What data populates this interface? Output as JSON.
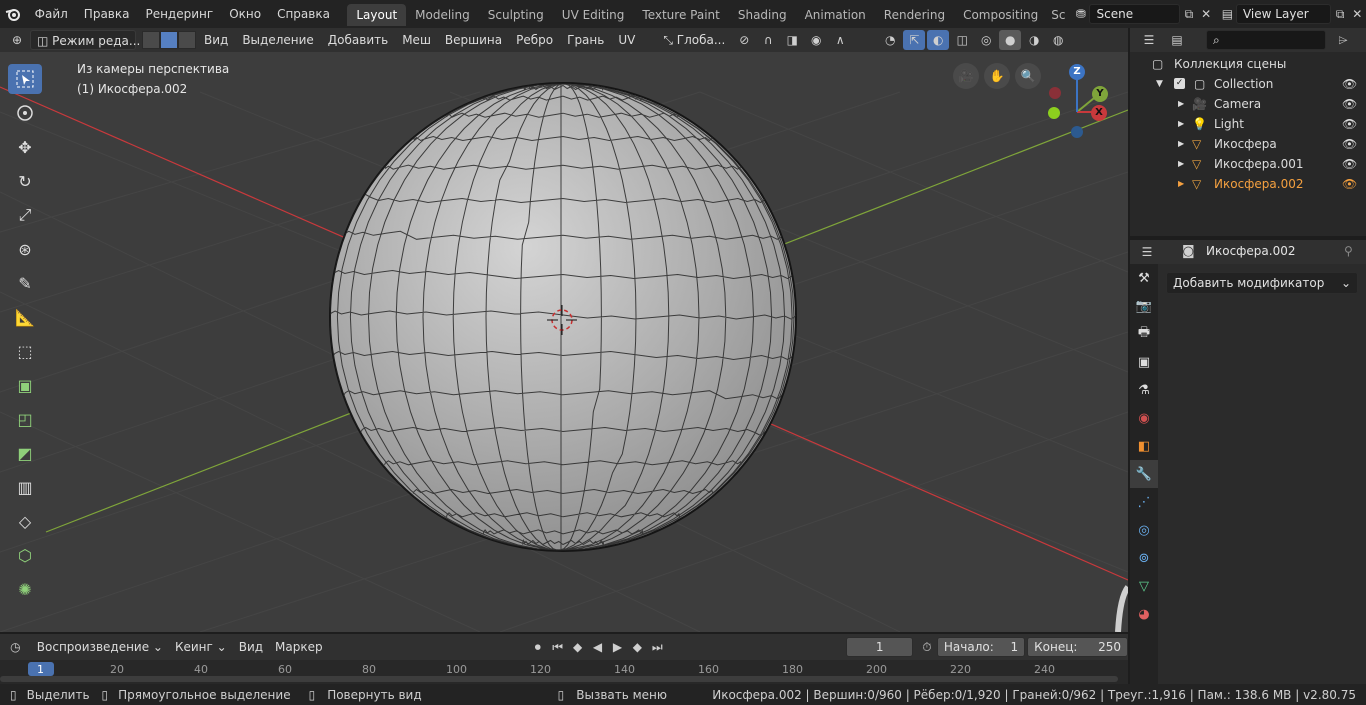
{
  "app": {
    "logo": "blender-logo-icon"
  },
  "menu": [
    "Файл",
    "Правка",
    "Рендеринг",
    "Окно",
    "Справка"
  ],
  "workspaces": [
    "Layout",
    "Modeling",
    "Sculpting",
    "UV Editing",
    "Texture Paint",
    "Shading",
    "Animation",
    "Rendering",
    "Compositing",
    "Scr"
  ],
  "active_workspace": "Layout",
  "scene": {
    "value": "Scene"
  },
  "view_layer": {
    "value": "View Layer"
  },
  "vp_header": {
    "mode": "Режим реда...",
    "menus": [
      "Вид",
      "Выделение",
      "Добавить",
      "Меш",
      "Вершина",
      "Ребро",
      "Грань",
      "UV"
    ],
    "transform": "Глоба..."
  },
  "viewport": {
    "view_name": "Из камеры перспектива",
    "object_label": "(1) Икосфера.002",
    "gizmo": {
      "x": "X",
      "y": "Y",
      "z": "Z"
    }
  },
  "outliner": {
    "title": "Коллекция сцены",
    "collection": "Collection",
    "items": [
      {
        "name": "Camera",
        "icon": "camera-icon"
      },
      {
        "name": "Light",
        "icon": "light-icon"
      },
      {
        "name": "Икосфера",
        "icon": "mesh-icon"
      },
      {
        "name": "Икосфера.001",
        "icon": "mesh-icon"
      },
      {
        "name": "Икосфера.002",
        "icon": "mesh-icon"
      }
    ]
  },
  "properties": {
    "object": "Икосфера.002",
    "add_modifier": "Добавить модификатор"
  },
  "timeline": {
    "playback": "Воспроизведение",
    "keying": "Кеинг",
    "view": "Вид",
    "marker": "Маркер",
    "current_frame": "1",
    "start_label": "Начало:",
    "start": "1",
    "end_label": "Конец:",
    "end": "250",
    "ruler": [
      "1",
      "20",
      "40",
      "60",
      "80",
      "100",
      "120",
      "140",
      "160",
      "180",
      "200",
      "220",
      "240"
    ]
  },
  "status": {
    "select": "Выделить",
    "box_select": "Прямоугольное выделение",
    "rotate_view": "Повернуть вид",
    "call_menu": "Вызвать меню",
    "stats": "Икосфера.002 | Вершин:0/960 | Рёбер:0/1,920 | Граней:0/962 | Треуг.:1,916 | Пам.: 138.6 MB | v2.80.75"
  },
  "colors": {
    "accent": "#4a72b0",
    "selected_text": "#f4a040",
    "x_axis": "#c8393c",
    "y_axis": "#7fa53a"
  }
}
